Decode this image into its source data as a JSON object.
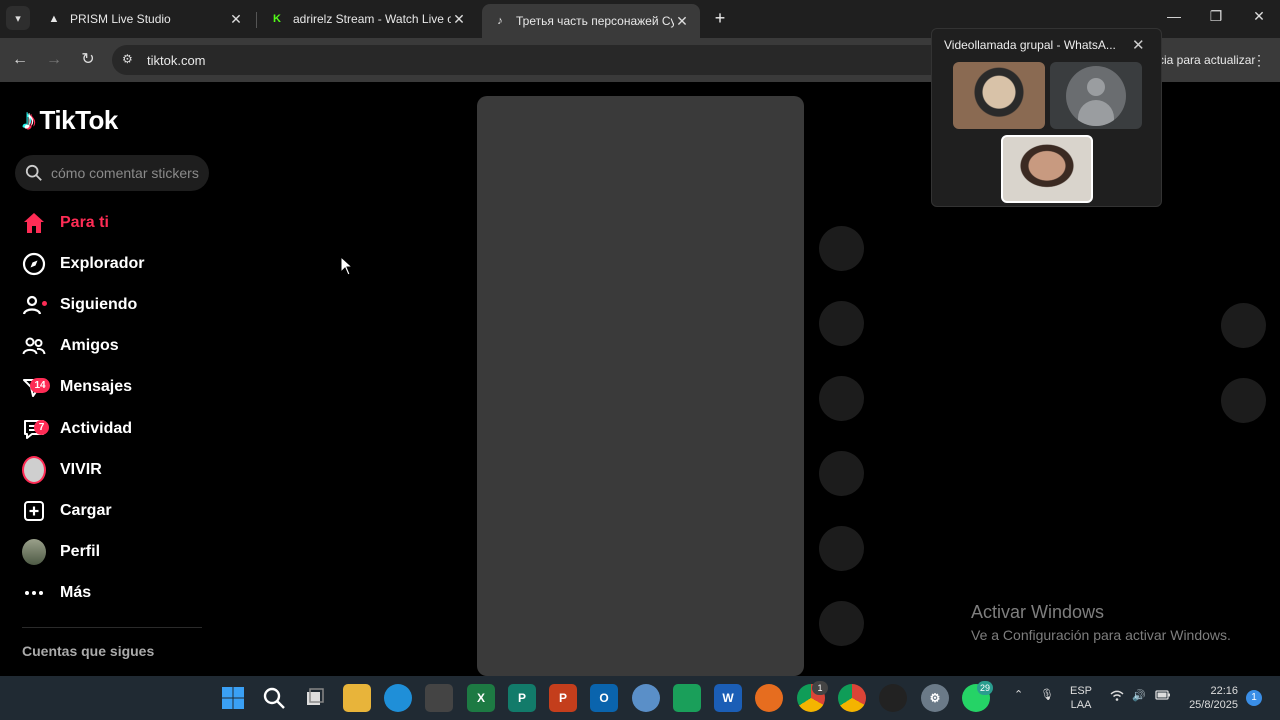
{
  "browser": {
    "tabs": [
      {
        "title": "PRISM Live Studio",
        "icon": "prism-icon"
      },
      {
        "title": "adrirelz Stream - Watch Live on",
        "icon": "kick-icon"
      },
      {
        "title": "Третья часть персонажей Сум",
        "icon": "tiktok-icon",
        "active": true
      }
    ],
    "url": "tiktok.com",
    "update_chip": "cia para actualizar"
  },
  "tiktok": {
    "logo_text": "TikTok",
    "search_placeholder": "cómo comentar stickers",
    "nav": [
      {
        "label": "Para ti",
        "icon": "home-icon",
        "active": true
      },
      {
        "label": "Explorador",
        "icon": "compass-icon"
      },
      {
        "label": "Siguiendo",
        "icon": "following-icon"
      },
      {
        "label": "Amigos",
        "icon": "friends-icon"
      },
      {
        "label": "Mensajes",
        "icon": "messages-icon",
        "badge": "14"
      },
      {
        "label": "Actividad",
        "icon": "activity-icon",
        "badge": "7"
      },
      {
        "label": "VIVIR",
        "icon": "live-avatar-icon"
      },
      {
        "label": "Cargar",
        "icon": "upload-icon"
      },
      {
        "label": "Perfil",
        "icon": "profile-avatar-icon"
      },
      {
        "label": "Más",
        "icon": "more-icon"
      }
    ],
    "section_title": "Cuentas que sigues"
  },
  "whatsapp_call": {
    "title": "Videollamada grupal - WhatsA..."
  },
  "watermark": {
    "line1": "Activar Windows",
    "line2": "Ve a Configuración para activar Windows."
  },
  "taskbar": {
    "language": "ESP",
    "language_sub": "LAA",
    "time": "22:16",
    "date": "25/8/2025",
    "notification_count": "1",
    "chrome_badge": "1",
    "whatsapp_badge": "29"
  }
}
